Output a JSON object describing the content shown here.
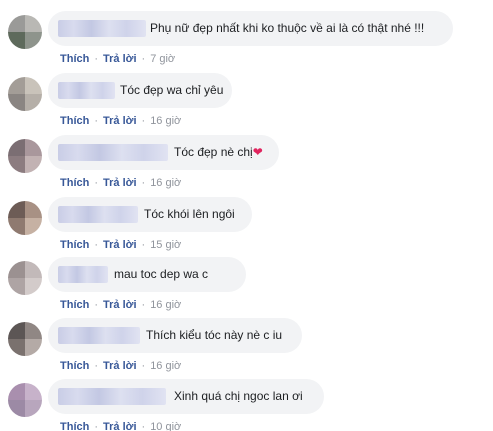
{
  "actions": {
    "like": "Thích",
    "reply": "Trả lời",
    "separator": "·"
  },
  "comments": [
    {
      "text": "Phụ nữ đẹp nhất khi ko thuộc về ai là có thật nhé !!!",
      "time": "7 giờ"
    },
    {
      "text": "Tóc đẹp wa chỉ yêu",
      "time": "16 giờ"
    },
    {
      "text": "Tóc đẹp nè chị",
      "emoji": "❤",
      "time": "16 giờ"
    },
    {
      "text": "Tóc khói lên ngôi",
      "time": "15 giờ"
    },
    {
      "text": "mau toc dep wa c",
      "time": "16 giờ"
    },
    {
      "text": "Thích kiểu tóc này nè c iu",
      "time": "16 giờ"
    },
    {
      "text": "Xinh quá chị ngoc lan ơi",
      "time": "10 giờ"
    }
  ],
  "colors": {
    "bubble": "#f2f3f5",
    "link": "#385898",
    "time": "#90949c",
    "heart": "#e0245e"
  }
}
